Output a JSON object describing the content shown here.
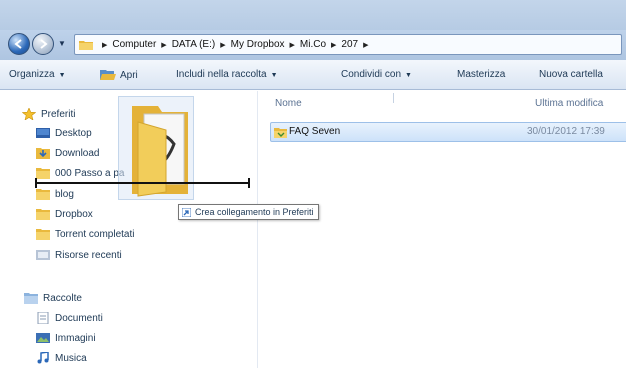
{
  "address": {
    "crumbs": [
      "Computer",
      "DATA (E:)",
      "My Dropbox",
      "Mi.Co",
      "207"
    ]
  },
  "toolbar": {
    "organize": "Organizza",
    "open": "Apri",
    "include": "Includi nella raccolta",
    "share": "Condividi con",
    "burn": "Masterizza",
    "new_folder": "Nuova cartella"
  },
  "sidebar": {
    "favorites_label": "Preferiti",
    "favorites": [
      "Desktop",
      "Download",
      "000 Passo a pa",
      "blog",
      "Dropbox",
      "Torrent completati",
      "Risorse recenti"
    ],
    "libraries_label": "Raccolte",
    "libraries": [
      "Documenti",
      "Immagini",
      "Musica"
    ]
  },
  "filelist": {
    "col_name": "Nome",
    "col_modified": "Ultima modifica",
    "rows": [
      {
        "name": "FAQ Seven",
        "modified": "30/01/2012 17:39"
      }
    ]
  },
  "drag": {
    "tooltip": "Crea collegamento in Preferiti"
  },
  "colors": {
    "folder": "#e9b93d",
    "accent": "#2b68b8"
  },
  "icons": {
    "back": "arrow-left-icon",
    "forward": "arrow-right-icon",
    "star": "star-icon",
    "folder": "folder-icon",
    "link": "shortcut-arrow-icon"
  }
}
